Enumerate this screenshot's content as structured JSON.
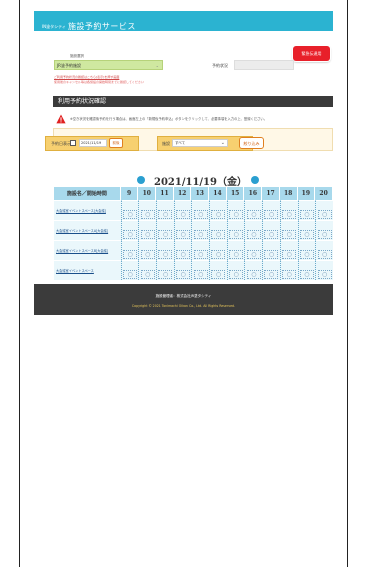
{
  "header": {
    "company": "IN塗タシティ",
    "service_title": "施設予約サービス"
  },
  "urgent_button": "緊急伝達用",
  "facility": {
    "label": "施設選択",
    "selected": "JR塗予約施設",
    "status_label": "予約状況"
  },
  "links": {
    "line1": "ご利用予約状況の確認はこちら[表示]を押す画面",
    "line2": "使用後のキャンセル等は各施設の開始時間までに確認してください"
  },
  "section_title": "利用予約状況確認",
  "notice": "※空き状況を確認後予約を行う場合は、画面左上の「新規仮予約申込」ボタンをクリックして、必要事項を入力の上、登録ください。",
  "filter": {
    "date_label": "予約日表示",
    "date_value": "2021/11/19",
    "today_button": "前後",
    "category_label": "施設",
    "category_value": "すべて",
    "filter_button": "絞り込み"
  },
  "current_date": "2021/11/19（金）",
  "grid": {
    "name_header": "施設名／開始時間",
    "hours": [
      "9",
      "10",
      "11",
      "12",
      "13",
      "14",
      "15",
      "16",
      "17",
      "18",
      "19",
      "20"
    ],
    "slot_mark": "○",
    "rows": [
      "大会議室イベントスペース[大会議]",
      "大会議室イベントスペースA[大会議]",
      "大会議室イベントスペースB[大会議]",
      "大会議室イベントスペース"
    ]
  },
  "footer": {
    "admin": "施設管理者：株式会社JR塗タシティ",
    "copyright": "Copyright © 2021 Tonimachi Oikan Co., Ltd. All Rights Reserved."
  },
  "colors": {
    "header": "#2bb3d1",
    "urgent": "#e8202a",
    "accent_orange": "#e08020",
    "grid_header": "#a8d9ec",
    "footer": "#3b3b3b"
  }
}
